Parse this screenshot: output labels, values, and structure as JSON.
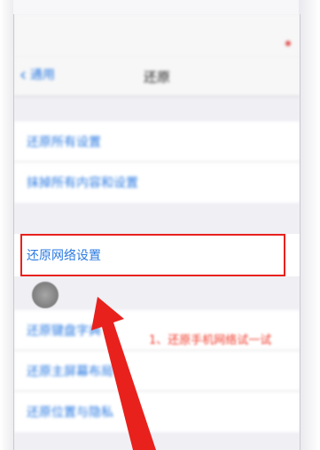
{
  "status_bar": {
    "left": "",
    "center": "",
    "right": ""
  },
  "nav": {
    "back_label": "通用",
    "title": "还原"
  },
  "group1": [
    {
      "label": "还原所有设置"
    },
    {
      "label": "抹掉所有内容和设置"
    }
  ],
  "highlighted_item": {
    "label": "还原网络设置"
  },
  "group2": [
    {
      "label": "还原键盘字典"
    },
    {
      "label": "还原主屏幕布局"
    },
    {
      "label": "还原位置与隐私"
    }
  ],
  "annotation": {
    "text": "1、还原手机网络试一试"
  },
  "colors": {
    "accent": "#2a7ae2",
    "highlight": "#e8211d",
    "background": "#efeff4"
  },
  "icons": {
    "back": "chevron-left-icon",
    "touch": "touch-indicator-icon",
    "arrow": "red-arrow-icon"
  }
}
